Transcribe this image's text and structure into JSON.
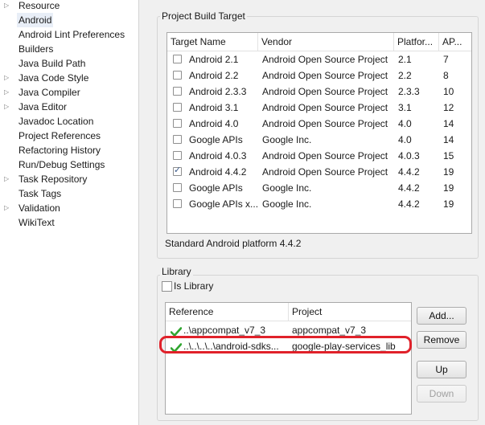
{
  "nav": {
    "items": [
      {
        "label": "Resource",
        "expandable": true,
        "selected": false
      },
      {
        "label": "Android",
        "expandable": false,
        "selected": true
      },
      {
        "label": "Android Lint Preferences",
        "expandable": false,
        "selected": false
      },
      {
        "label": "Builders",
        "expandable": false,
        "selected": false
      },
      {
        "label": "Java Build Path",
        "expandable": false,
        "selected": false
      },
      {
        "label": "Java Code Style",
        "expandable": true,
        "selected": false
      },
      {
        "label": "Java Compiler",
        "expandable": true,
        "selected": false
      },
      {
        "label": "Java Editor",
        "expandable": true,
        "selected": false
      },
      {
        "label": "Javadoc Location",
        "expandable": false,
        "selected": false
      },
      {
        "label": "Project References",
        "expandable": false,
        "selected": false
      },
      {
        "label": "Refactoring History",
        "expandable": false,
        "selected": false
      },
      {
        "label": "Run/Debug Settings",
        "expandable": false,
        "selected": false
      },
      {
        "label": "Task Repository",
        "expandable": true,
        "selected": false
      },
      {
        "label": "Task Tags",
        "expandable": false,
        "selected": false
      },
      {
        "label": "Validation",
        "expandable": true,
        "selected": false
      },
      {
        "label": "WikiText",
        "expandable": false,
        "selected": false
      }
    ]
  },
  "build_target": {
    "group_title": "Project Build Target",
    "columns": [
      "Target Name",
      "Vendor",
      "Platfor...",
      "AP..."
    ],
    "rows": [
      {
        "name": "Android 2.1",
        "vendor": "Android Open Source Project",
        "platform": "2.1",
        "api": "7",
        "checked": false
      },
      {
        "name": "Android 2.2",
        "vendor": "Android Open Source Project",
        "platform": "2.2",
        "api": "8",
        "checked": false
      },
      {
        "name": "Android 2.3.3",
        "vendor": "Android Open Source Project",
        "platform": "2.3.3",
        "api": "10",
        "checked": false
      },
      {
        "name": "Android 3.1",
        "vendor": "Android Open Source Project",
        "platform": "3.1",
        "api": "12",
        "checked": false
      },
      {
        "name": "Android 4.0",
        "vendor": "Android Open Source Project",
        "platform": "4.0",
        "api": "14",
        "checked": false
      },
      {
        "name": "Google APIs",
        "vendor": "Google Inc.",
        "platform": "4.0",
        "api": "14",
        "checked": false
      },
      {
        "name": "Android 4.0.3",
        "vendor": "Android Open Source Project",
        "platform": "4.0.3",
        "api": "15",
        "checked": false
      },
      {
        "name": "Android 4.4.2",
        "vendor": "Android Open Source Project",
        "platform": "4.4.2",
        "api": "19",
        "checked": true
      },
      {
        "name": "Google APIs",
        "vendor": "Google Inc.",
        "platform": "4.4.2",
        "api": "19",
        "checked": false
      },
      {
        "name": "Google APIs x...",
        "vendor": "Google Inc.",
        "platform": "4.4.2",
        "api": "19",
        "checked": false
      }
    ],
    "status": "Standard Android platform 4.4.2"
  },
  "library": {
    "group_title": "Library",
    "is_library_label": "Is Library",
    "is_library_checked": false,
    "columns": [
      "Reference",
      "Project"
    ],
    "rows": [
      {
        "reference": "..\\appcompat_v7_3",
        "project": "appcompat_v7_3",
        "icon": "green-check-icon"
      },
      {
        "reference": "..\\..\\..\\..\\android-sdks...",
        "project": "google-play-services_lib",
        "icon": "green-check-icon"
      }
    ],
    "buttons": {
      "add": "Add...",
      "remove": "Remove",
      "up": "Up",
      "down": "Down"
    }
  },
  "colors": {
    "highlight": "#e0212a",
    "check": "#2fa52f"
  }
}
